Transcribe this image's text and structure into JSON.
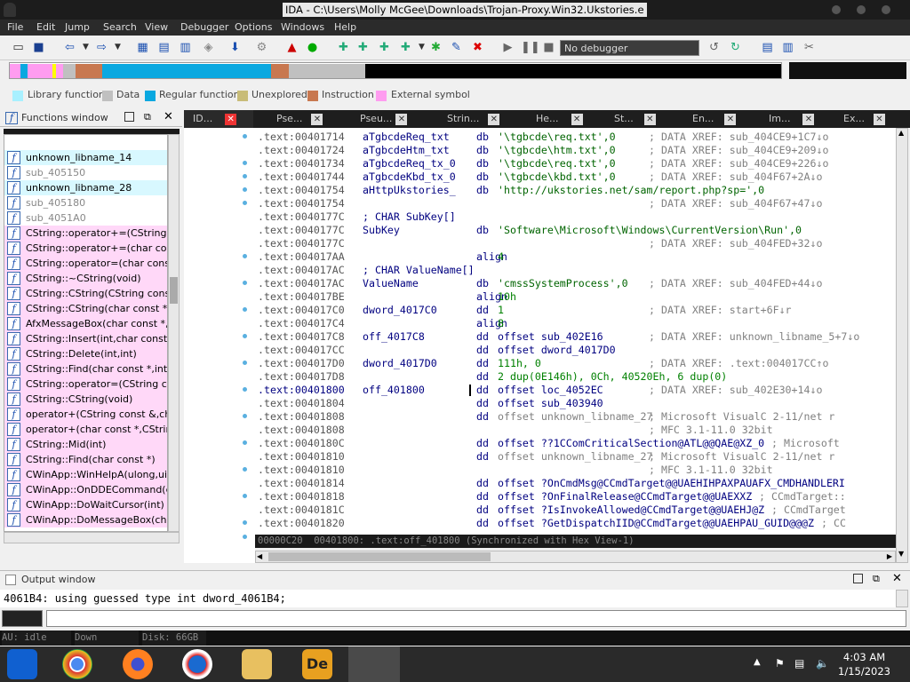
{
  "window": {
    "title": "IDA - C:\\Users\\Molly McGee\\Downloads\\Trojan-Proxy.Win32.Ukstories.e"
  },
  "menu": [
    "File",
    "Edit",
    "Jump",
    "Search",
    "View",
    "Debugger",
    "Options",
    "Windows",
    "Help"
  ],
  "toolbar": {
    "debugger_select": "No debugger"
  },
  "legend": [
    {
      "label": "Library function",
      "color": "#a8f0ff"
    },
    {
      "label": "Data",
      "color": "#c0c0c0"
    },
    {
      "label": "Regular function",
      "color": "#0aa8e0"
    },
    {
      "label": "Unexplored",
      "color": "#c8bc78"
    },
    {
      "label": "Instruction",
      "color": "#c87850"
    },
    {
      "label": "External symbol",
      "color": "#ff9cf0"
    }
  ],
  "functions_window": {
    "title": "Functions window",
    "items": [
      {
        "name": "unknown_libname_14",
        "bg": "#d8f8ff"
      },
      {
        "name": "sub_405150",
        "bg": "#ffffff",
        "dim": true
      },
      {
        "name": "unknown_libname_28",
        "bg": "#d8f8ff"
      },
      {
        "name": "sub_405180",
        "bg": "#ffffff",
        "dim": true
      },
      {
        "name": "sub_4051A0",
        "bg": "#ffffff",
        "dim": true
      },
      {
        "name": "CString::operator+=(CString co",
        "bg": "#ffd8f8"
      },
      {
        "name": "CString::operator+=(char const",
        "bg": "#ffd8f8"
      },
      {
        "name": "CString::operator=(char const",
        "bg": "#ffd8f8"
      },
      {
        "name": "CString::~CString(void)",
        "bg": "#ffd8f8"
      },
      {
        "name": "CString::CString(CString const &",
        "bg": "#ffd8f8"
      },
      {
        "name": "CString::CString(char const *)",
        "bg": "#ffd8f8"
      },
      {
        "name": "AfxMessageBox(char const *,u",
        "bg": "#ffd8f8"
      },
      {
        "name": "CString::Insert(int,char const *",
        "bg": "#ffd8f8"
      },
      {
        "name": "CString::Delete(int,int)",
        "bg": "#ffd8f8"
      },
      {
        "name": "CString::Find(char const *,int)",
        "bg": "#ffd8f8"
      },
      {
        "name": "CString::operator=(CString con",
        "bg": "#ffd8f8"
      },
      {
        "name": "CString::CString(void)",
        "bg": "#ffd8f8"
      },
      {
        "name": "operator+(CString const &,cha",
        "bg": "#ffd8f8"
      },
      {
        "name": "operator+(char const *,CString",
        "bg": "#ffd8f8"
      },
      {
        "name": "CString::Mid(int)",
        "bg": "#ffd8f8"
      },
      {
        "name": "CString::Find(char const *)",
        "bg": "#ffd8f8"
      },
      {
        "name": "CWinApp::WinHelpA(ulong,ui",
        "bg": "#ffd8f8"
      },
      {
        "name": "CWinApp::OnDDECommand(ch",
        "bg": "#ffd8f8"
      },
      {
        "name": "CWinApp::DoWaitCursor(int)",
        "bg": "#ffd8f8"
      },
      {
        "name": "CWinApp::DoMessageBox(cha",
        "bg": "#ffd8f8"
      }
    ]
  },
  "tabs": [
    {
      "label": "ID...",
      "active": true
    },
    {
      "label": "Pse..."
    },
    {
      "label": "Pseu..."
    },
    {
      "label": "Strin..."
    },
    {
      "label": "He..."
    },
    {
      "label": "St..."
    },
    {
      "label": "En..."
    },
    {
      "label": "Im..."
    },
    {
      "label": "Ex..."
    }
  ],
  "disasm_lines": [
    {
      "a": ".text:00401714",
      "l": "aTgbcdeReq_txt",
      "i": "db",
      "o": "'\\tgbcde\\req.txt',0",
      "c": "; DATA XREF: sub_404CE9+1C7↓o"
    },
    {
      "a": ".text:00401724",
      "l": "aTgbcdeHtm_txt",
      "i": "db",
      "o": "'\\tgbcde\\htm.txt',0",
      "c": "; DATA XREF: sub_404CE9+209↓o"
    },
    {
      "a": ".text:00401734",
      "l": "aTgbcdeReq_tx_0",
      "i": "db",
      "o": "'\\tgbcde\\req.txt',0",
      "c": "; DATA XREF: sub_404CE9+226↓o"
    },
    {
      "a": ".text:00401744",
      "l": "aTgbcdeKbd_tx_0",
      "i": "db",
      "o": "'\\tgbcde\\kbd.txt',0",
      "c": "; DATA XREF: sub_404F67+2A↓o"
    },
    {
      "a": ".text:00401754",
      "l": "aHttpUkstories_",
      "i": "db",
      "o": "'http://ukstories.net/sam/report.php?sp=',0",
      "c": ""
    },
    {
      "a": ".text:00401754",
      "l": "",
      "i": "",
      "o": "",
      "c": "; DATA XREF: sub_404F67+47↓o"
    },
    {
      "a": ".text:0040177C",
      "l": "; CHAR SubKey[]",
      "i": "",
      "o": "",
      "c": ""
    },
    {
      "a": ".text:0040177C",
      "l": "SubKey",
      "i": "db",
      "o": "'Software\\Microsoft\\Windows\\CurrentVersion\\Run',0",
      "c": ""
    },
    {
      "a": ".text:0040177C",
      "l": "",
      "i": "",
      "o": "",
      "c": "; DATA XREF: sub_404FED+32↓o"
    },
    {
      "a": ".text:004017AA",
      "l": "",
      "i": "align",
      "o": "4",
      "c": ""
    },
    {
      "a": ".text:004017AC",
      "l": "; CHAR ValueName[]",
      "i": "",
      "o": "",
      "c": ""
    },
    {
      "a": ".text:004017AC",
      "l": "ValueName",
      "i": "db",
      "o": "'cmssSystemProcess',0",
      "c": "; DATA XREF: sub_404FED+44↓o"
    },
    {
      "a": ".text:004017BE",
      "l": "",
      "i": "align",
      "o": "10h",
      "c": ""
    },
    {
      "a": ".text:004017C0",
      "l": "dword_4017C0",
      "i": "dd",
      "o": "1",
      "c": "; DATA XREF: start+6F↓r"
    },
    {
      "a": ".text:004017C4",
      "l": "",
      "i": "align",
      "o": "8",
      "c": ""
    },
    {
      "a": ".text:004017C8",
      "l": "off_4017C8",
      "i": "dd",
      "o": "offset sub_402E16",
      "c": "; DATA XREF: unknown_libname_5+7↓o"
    },
    {
      "a": ".text:004017CC",
      "l": "",
      "i": "dd",
      "o": "offset dword_4017D0",
      "c": ""
    },
    {
      "a": ".text:004017D0",
      "l": "dword_4017D0",
      "i": "dd",
      "o": "111h, 0",
      "c": "; DATA XREF: .text:004017CC↑o"
    },
    {
      "a": ".text:004017D8",
      "l": "",
      "i": "dd",
      "o": "2 dup(0E146h), 0Ch, 40520Eh, 6 dup(0)",
      "c": ""
    },
    {
      "a": ".text:00401800",
      "l": "off_401800",
      "i": "dd",
      "o": "offset loc_4052EC",
      "c": "; DATA XREF: sub_402E30+14↓o",
      "cur": true
    },
    {
      "a": ".text:00401804",
      "l": "",
      "i": "dd",
      "o": "offset sub_403940",
      "c": ""
    },
    {
      "a": ".text:00401808",
      "l": "",
      "i": "dd",
      "o": "offset unknown_libname_27",
      "c": "; Microsoft VisualC 2-11/net r"
    },
    {
      "a": ".text:00401808",
      "l": "",
      "i": "",
      "o": "",
      "c": "; MFC 3.1-11.0 32bit"
    },
    {
      "a": ".text:0040180C",
      "l": "",
      "i": "dd",
      "o": "offset ??1CComCriticalSection@ATL@@QAE@XZ_0",
      "c": "; Microsoft"
    },
    {
      "a": ".text:00401810",
      "l": "",
      "i": "dd",
      "o": "offset unknown_libname_27",
      "c": "; Microsoft VisualC 2-11/net r"
    },
    {
      "a": ".text:00401810",
      "l": "",
      "i": "",
      "o": "",
      "c": "; MFC 3.1-11.0 32bit"
    },
    {
      "a": ".text:00401814",
      "l": "",
      "i": "dd",
      "o": "offset ?OnCmdMsg@CCmdTarget@@UAEHIHPAXPAUAFX_CMDHANDLERI",
      "c": ""
    },
    {
      "a": ".text:00401818",
      "l": "",
      "i": "dd",
      "o": "offset ?OnFinalRelease@CCmdTarget@@UAEXXZ",
      "c": "; CCmdTarget::"
    },
    {
      "a": ".text:0040181C",
      "l": "",
      "i": "dd",
      "o": "offset ?IsInvokeAllowed@CCmdTarget@@UAEHJ@Z",
      "c": "; CCmdTarget"
    },
    {
      "a": ".text:00401820",
      "l": "",
      "i": "dd",
      "o": "offset ?GetDispatchIID@CCmdTarget@@UAEHPAU_GUID@@@Z",
      "c": "; CC"
    }
  ],
  "sync_status": "00000C20  00401800: .text:off_401800 (Synchronized with Hex View-1)",
  "output_window": {
    "title": "Output window",
    "text": "4061B4: using guessed type int dword_4061B4;"
  },
  "statusbar": {
    "state": "AU:  idle",
    "direction": "Down",
    "disk": "Disk: 66GB"
  },
  "clock": {
    "time": "4:03 AM",
    "date": "1/15/2023"
  }
}
